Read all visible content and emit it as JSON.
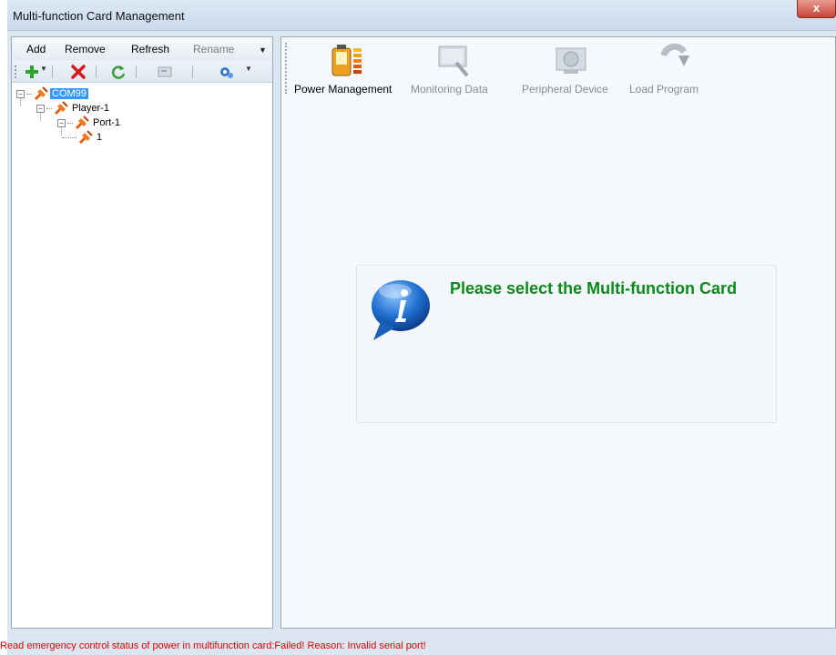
{
  "window": {
    "title": "Multi-function Card Management",
    "close_label": "x"
  },
  "menu": {
    "items": [
      {
        "label": "Add",
        "enabled": true
      },
      {
        "label": "Remove",
        "enabled": true
      },
      {
        "label": "Refresh",
        "enabled": true
      },
      {
        "label": "Rename",
        "enabled": false
      }
    ]
  },
  "toolbar": {
    "buttons": [
      {
        "icon": "add-icon"
      },
      {
        "icon": "delete-icon"
      },
      {
        "icon": "refresh-icon"
      },
      {
        "icon": "rename-icon"
      },
      {
        "icon": "settings-icon"
      }
    ]
  },
  "tree": {
    "nodes": [
      {
        "label": "COM99",
        "selected": true,
        "icon": "connector-icon"
      },
      {
        "label": "Player-1",
        "selected": false,
        "icon": "connector-icon"
      },
      {
        "label": "Port-1",
        "selected": false,
        "icon": "connector-icon"
      },
      {
        "label": "1",
        "selected": false,
        "icon": "connector-icon"
      }
    ]
  },
  "tabs": [
    {
      "label": "Power Management",
      "icon": "battery-icon",
      "active": true
    },
    {
      "label": "Monitoring Data",
      "icon": "monitor-icon",
      "active": false
    },
    {
      "label": "Peripheral Device",
      "icon": "camera-device-icon",
      "active": false
    },
    {
      "label": "Load Program",
      "icon": "download-arrow-icon",
      "active": false
    }
  ],
  "message": {
    "icon": "info-icon",
    "text": "Please select the Multi-function Card"
  },
  "status": {
    "text": "Read emergency control status of power in multifunction card:Failed! Reason: Invalid serial port!"
  },
  "colors": {
    "message_text": "#0a8a1a",
    "status_error": "#e00000",
    "selection": "#3399ff"
  }
}
